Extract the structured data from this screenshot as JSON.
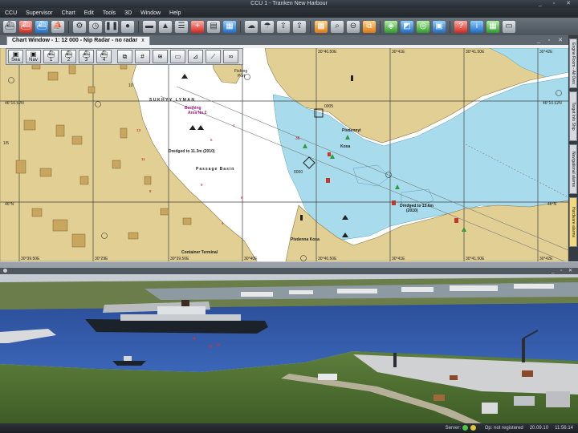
{
  "window": {
    "title": "CCU 1 - Tranken New Harbour",
    "controls": "_ ▫ ✕"
  },
  "menu": [
    "CCU",
    "Supervisor",
    "Chart",
    "Edit",
    "Tools",
    "3D",
    "Window",
    "Help"
  ],
  "toolbar": {
    "buttons": [
      {
        "name": "ship-icon",
        "glyph": "⛴",
        "style": "grey"
      },
      {
        "name": "ship-red-icon",
        "glyph": "⛴",
        "style": "red"
      },
      {
        "name": "ship-blue-icon",
        "glyph": "⛴",
        "style": "blue"
      },
      {
        "name": "boat-icon",
        "glyph": "⛵",
        "style": "grey"
      },
      {
        "sep": true
      },
      {
        "name": "settings-icon",
        "glyph": "⚙",
        "style": "grey"
      },
      {
        "name": "clock-icon",
        "glyph": "◷",
        "style": "grey"
      },
      {
        "name": "pause-icon",
        "glyph": "❚❚",
        "style": "grey"
      },
      {
        "name": "record-icon",
        "glyph": "●",
        "style": "grey"
      },
      {
        "sep": true
      },
      {
        "name": "vessel-icon",
        "glyph": "▬",
        "style": "grey"
      },
      {
        "name": "vessel-tow-icon",
        "glyph": "▲",
        "style": "grey"
      },
      {
        "name": "vessel-list-icon",
        "glyph": "☰",
        "style": "grey"
      },
      {
        "name": "add-vessel-icon",
        "glyph": "+",
        "style": "red"
      },
      {
        "name": "document-icon",
        "glyph": "▤",
        "style": "grey"
      },
      {
        "name": "save-icon",
        "glyph": "▦",
        "style": "blue"
      },
      {
        "sep": true
      },
      {
        "name": "cloud-icon",
        "glyph": "☁",
        "style": "grey"
      },
      {
        "name": "weather-icon",
        "glyph": "☂",
        "style": "grey"
      },
      {
        "name": "upload-icon",
        "glyph": "⇧",
        "style": "grey"
      },
      {
        "name": "export-icon",
        "glyph": "⇪",
        "style": "grey"
      },
      {
        "sep": true
      },
      {
        "name": "palette-icon",
        "glyph": "▩",
        "style": "orange"
      },
      {
        "name": "zoom-icon",
        "glyph": "⌕",
        "style": "grey"
      },
      {
        "name": "zoom-out-icon",
        "glyph": "⊖",
        "style": "grey"
      },
      {
        "name": "network-icon",
        "glyph": "⧉",
        "style": "orange"
      },
      {
        "sep": true
      },
      {
        "name": "layers-icon",
        "glyph": "◈",
        "style": "green"
      },
      {
        "name": "map-icon",
        "glyph": "◩",
        "style": "blue"
      },
      {
        "name": "target-icon",
        "glyph": "◎",
        "style": "green"
      },
      {
        "name": "monitor-icon",
        "glyph": "▣",
        "style": "blue"
      },
      {
        "sep": true
      },
      {
        "name": "help-icon",
        "glyph": "?",
        "style": "red"
      },
      {
        "name": "info-icon",
        "glyph": "i",
        "style": "blue"
      },
      {
        "name": "tiles-icon",
        "glyph": "▦",
        "style": "green"
      },
      {
        "name": "window-icon",
        "glyph": "▭",
        "style": "grey"
      }
    ]
  },
  "chart_window": {
    "tab_label": "Chart Window - 1: 12 000 - Nip Radar - no radar",
    "tab_close": "x",
    "controls": "_ ▫ ✕",
    "tools": [
      {
        "name": "show-sea-button",
        "glyph": "▣",
        "label": "Sea"
      },
      {
        "name": "show-nav-button",
        "glyph": "▣",
        "label": "Nav"
      },
      {
        "name": "vessel-1-button",
        "glyph": "⛴",
        "label": "1"
      },
      {
        "name": "vessel-2-button",
        "glyph": "⛴",
        "label": "2"
      },
      {
        "name": "vessel-3-button",
        "glyph": "⛴",
        "label": "3"
      },
      {
        "name": "vessel-4-button",
        "glyph": "⛴",
        "label": "4"
      },
      {
        "name": "windows-button",
        "glyph": "⧉",
        "label": ""
      },
      {
        "name": "grid-button",
        "glyph": "#",
        "label": ""
      },
      {
        "name": "radar-button",
        "glyph": "≋",
        "label": ""
      },
      {
        "name": "layer-button",
        "glyph": "▭",
        "label": ""
      },
      {
        "name": "measure-button",
        "glyph": "⊿",
        "label": ""
      },
      {
        "name": "draw-button",
        "glyph": "⟋",
        "label": ""
      },
      {
        "name": "rings-button",
        "glyph": "∞",
        "label": ""
      }
    ]
  },
  "chart": {
    "lat_labels": [
      "46°10.52N",
      "46°10.52N",
      "46°N",
      "46°N"
    ],
    "lon_labels_top": [
      "30°40.50E",
      "30°41E",
      "30°41.50E",
      "30°42E"
    ],
    "lon_labels_bottom": [
      "30°39.50E",
      "30°29E",
      "30°39.50E",
      "30°40E",
      "30°40.50E",
      "30°41E",
      "30°41.50E",
      "30°42E"
    ],
    "texts": {
      "fishing_port": "Fishing",
      "fishing_port2": "Port",
      "sukhyy_lyman": "SUKHYY LYMAN",
      "berthing_area": "Berthing",
      "berthing_area2": "Area No.2",
      "dredged_1": "Dredged to 11.3m (2010)",
      "passage": "Passage Basin",
      "dredged_2": "Dredged to 13.6m",
      "dredged_2b": "(2010)",
      "pivdenna": "Pivdenna Kosa",
      "kosa": "Kosa",
      "pivdennyi": "Pivdennyi",
      "container": "Container Terminal",
      "l1": "0005",
      "l2": "0000",
      "l3": "36",
      "l4": "10",
      "l5": "1/5"
    }
  },
  "side_tabs": [
    "Engine Room - All Own",
    "Target Info Ship",
    "Navigational alarms",
    "Hardware alarms"
  ],
  "status": {
    "server": "Server:",
    "op": "Op: not registered",
    "date": "20.09.10",
    "time": "11:56:14"
  }
}
